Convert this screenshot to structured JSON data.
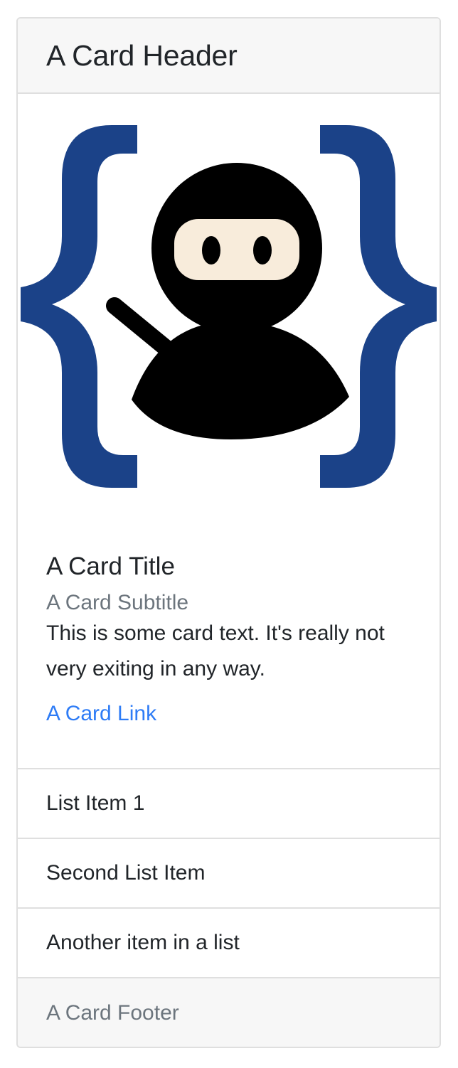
{
  "card": {
    "header": "A Card Header",
    "image": {
      "icon": "ninja-logo-icon",
      "brace_color": "#1b4288",
      "figure_color": "#000000",
      "face_color": "#f8ecdb"
    },
    "title": "A Card Title",
    "subtitle": "A Card Subtitle",
    "text": "This is some card text. It's really not very exiting in any way.",
    "link": "A Card Link",
    "list_items": [
      "List Item 1",
      "Second List Item",
      "Another item in a list"
    ],
    "footer": "A Card Footer"
  },
  "colors": {
    "link": "#2e7cf6",
    "muted": "#6c757d",
    "header_bg": "#f7f7f7",
    "border": "#dfdfdf"
  }
}
